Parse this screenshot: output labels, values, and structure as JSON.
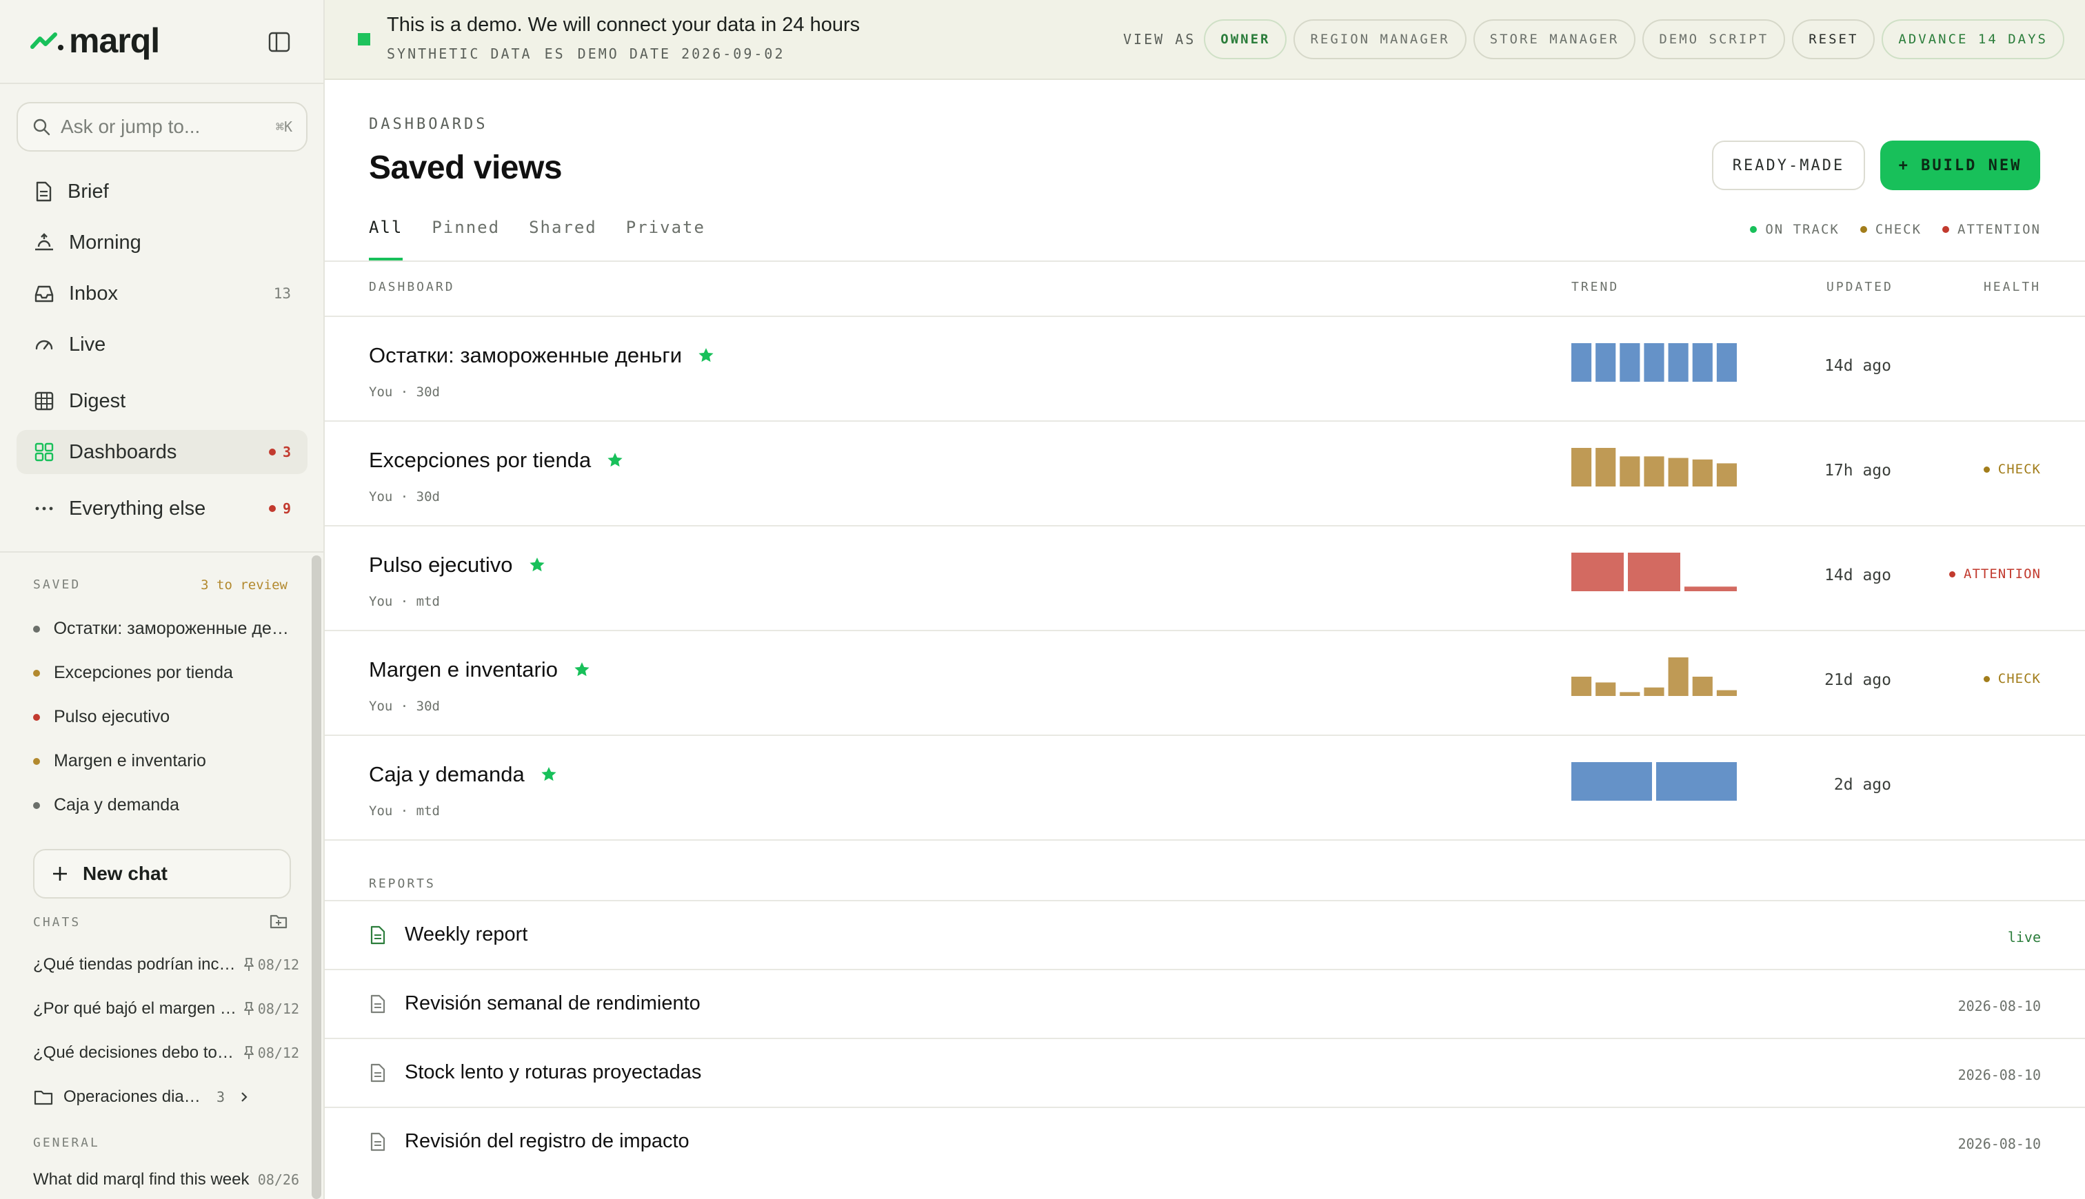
{
  "app": {
    "name": "marql"
  },
  "search": {
    "placeholder": "Ask or jump to...",
    "shortcut": "⌘K"
  },
  "nav": [
    {
      "label": "Brief",
      "icon": "document-icon"
    },
    {
      "label": "Morning",
      "icon": "sunrise-icon"
    },
    {
      "label": "Inbox",
      "icon": "inbox-icon",
      "count": "13"
    },
    {
      "label": "Live",
      "icon": "gauge-icon"
    },
    {
      "label": "Digest",
      "icon": "grid-table-icon"
    },
    {
      "label": "Dashboards",
      "icon": "dashboard-grid-icon",
      "badge": "3",
      "active": true
    },
    {
      "label": "Everything else",
      "icon": "more-dots-icon",
      "badge": "9"
    }
  ],
  "saved": {
    "heading": "SAVED",
    "review": "3 to review",
    "items": [
      {
        "label": "Остатки: замороженные деньги",
        "status_color": "#6b6f6a"
      },
      {
        "label": "Excepciones por tienda",
        "status_color": "#b2892e"
      },
      {
        "label": "Pulso ejecutivo",
        "status_color": "#c23a2e"
      },
      {
        "label": "Margen e inventario",
        "status_color": "#b2892e"
      },
      {
        "label": "Caja y demanda",
        "status_color": "#6b6f6a"
      }
    ]
  },
  "new_chat": {
    "label": "New chat"
  },
  "chats": {
    "heading": "CHATS",
    "items": [
      {
        "label": "¿Qué tiendas podrían incumplir",
        "date": "08/12",
        "pinned": true
      },
      {
        "label": "¿Por qué bajó el margen esta semana",
        "date": "08/12",
        "pinned": true
      },
      {
        "label": "¿Qué decisiones debo tomar hoy",
        "date": "08/12",
        "pinned": true
      }
    ],
    "folder": {
      "label": "Operaciones diarias",
      "count": "3"
    }
  },
  "general": {
    "heading": "GENERAL",
    "items": [
      {
        "label": "What did marql find this week",
        "date": "08/26"
      }
    ]
  },
  "banner": {
    "title": "This is a demo. We will connect your data in 24 hours",
    "sub": [
      "SYNTHETIC DATA",
      "ES",
      "DEMO DATE 2026-09-02"
    ],
    "view_as_label": "VIEW AS",
    "buttons": [
      "OWNER",
      "REGION MANAGER",
      "STORE MANAGER",
      "DEMO SCRIPT",
      "RESET",
      "ADVANCE 14 DAYS"
    ]
  },
  "page": {
    "eyebrow": "DASHBOARDS",
    "title": "Saved views",
    "ready_made": "READY-MADE",
    "build_new": "+ BUILD NEW",
    "tabs": [
      "All",
      "Pinned",
      "Shared",
      "Private"
    ],
    "legend": [
      {
        "label": "ON TRACK",
        "color": "#18c05a"
      },
      {
        "label": "CHECK",
        "color": "#a27d1b"
      },
      {
        "label": "ATTENTION",
        "color": "#c23a2e"
      }
    ],
    "columns": {
      "dashboard": "DASHBOARD",
      "trend": "TREND",
      "updated": "UPDATED",
      "health": "HEALTH"
    }
  },
  "dashboards": [
    {
      "name": "Остатки: замороженные деньги",
      "meta": "You · 30d",
      "updated": "14d ago",
      "health": "",
      "trend_color": "#6592c8",
      "trend": [
        1,
        1,
        1,
        1,
        1,
        1,
        1
      ]
    },
    {
      "name": "Excepciones por tienda",
      "meta": "You · 30d",
      "updated": "17h ago",
      "health": "CHECK",
      "trend_color": "#bf9a55",
      "trend": [
        1,
        1,
        0.78,
        0.78,
        0.74,
        0.7,
        0.6
      ]
    },
    {
      "name": "Pulso ejecutivo",
      "meta": "You · mtd",
      "updated": "14d ago",
      "health": "ATTENTION",
      "trend_color": "#d36a61",
      "trend": [
        1,
        1,
        0.12
      ]
    },
    {
      "name": "Margen e inventario",
      "meta": "You · 30d",
      "updated": "21d ago",
      "health": "CHECK",
      "trend_color": "#bf9a55",
      "trend": [
        0.5,
        0.35,
        0.1,
        0.22,
        1,
        0.5,
        0.15
      ]
    },
    {
      "name": "Caja y demanda",
      "meta": "You · mtd",
      "updated": "2d ago",
      "health": "",
      "trend_color": "#6592c8",
      "trend": [
        1,
        1
      ]
    }
  ],
  "reports": {
    "heading": "REPORTS",
    "items": [
      {
        "name": "Weekly report",
        "date": "live",
        "accent": true
      },
      {
        "name": "Revisión semanal de rendimiento",
        "date": "2026-08-10"
      },
      {
        "name": "Stock lento y roturas proyectadas",
        "date": "2026-08-10"
      },
      {
        "name": "Revisión del registro de impacto",
        "date": "2026-08-10"
      }
    ]
  },
  "colors": {
    "accent": "#18c05a",
    "check": "#a27d1b",
    "attention": "#c23a2e"
  }
}
